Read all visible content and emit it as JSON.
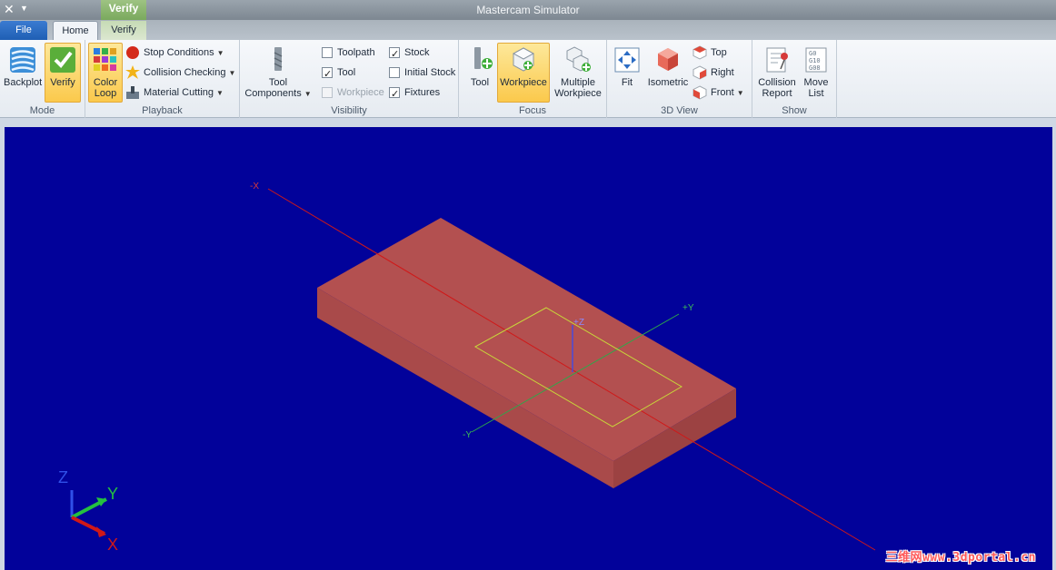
{
  "window": {
    "title": "Mastercam Simulator",
    "context_tab_label": "Verify"
  },
  "tabs": {
    "file": "File",
    "home": "Home",
    "verify": "Verify"
  },
  "ribbon": {
    "mode": {
      "label": "Mode",
      "backplot": "Backplot",
      "verify": "Verify"
    },
    "playback": {
      "label": "Playback",
      "color_loop_line1": "Color",
      "color_loop_line2": "Loop",
      "stop_conditions": "Stop Conditions",
      "collision_checking": "Collision Checking",
      "material_cutting": "Material Cutting"
    },
    "visibility": {
      "label": "Visibility",
      "tool_components_line1": "Tool",
      "tool_components_line2": "Components",
      "toolpath": "Toolpath",
      "tool": "Tool",
      "workpiece": "Workpiece",
      "stock": "Stock",
      "initial_stock": "Initial Stock",
      "fixtures": "Fixtures"
    },
    "focus": {
      "label": "Focus",
      "tool": "Tool",
      "workpiece": "Workpiece",
      "multiple_line1": "Multiple",
      "multiple_line2": "Workpiece"
    },
    "view3d": {
      "label": "3D View",
      "fit": "Fit",
      "isometric": "Isometric",
      "top": "Top",
      "right": "Right",
      "front": "Front"
    },
    "show": {
      "label": "Show",
      "collision_line1": "Collision",
      "collision_line2": "Report",
      "move_line1": "Move",
      "move_line2": "List"
    }
  },
  "viewport": {
    "axis_labels": {
      "neg_x": "-X",
      "pos_y": "+Y",
      "neg_y": "-Y",
      "pos_z": "+Z"
    },
    "triad": {
      "x": "X",
      "y": "Y",
      "z": "Z"
    },
    "watermark": "三维网www.3dportal.cn",
    "colors": {
      "background": "#02029a",
      "stock": "#b35050",
      "x_axis": "#d01818",
      "y_axis": "#2ea84a",
      "selection": "#c8d63a"
    }
  }
}
